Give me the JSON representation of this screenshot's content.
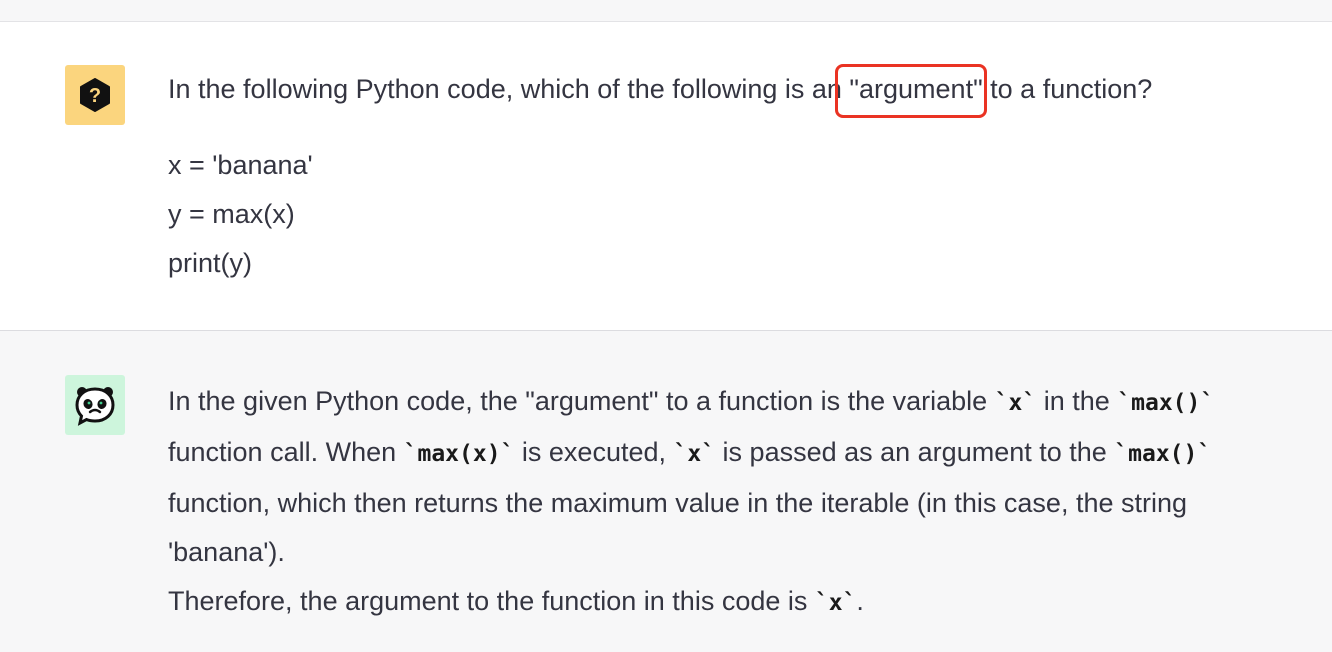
{
  "question": {
    "text_before": "In the following Python code, which of the following is an ",
    "highlight": "\"argument\"",
    "text_after": " to a function?",
    "code_lines": [
      "x = 'banana'",
      "y = max(x)",
      "print(y)"
    ]
  },
  "answer": {
    "p1_a": "In the given Python code, the \"argument\" to a function is the variable ",
    "p1_code1": "`x`",
    "p1_b": " in the ",
    "p1_code2": "`max()`",
    "p1_c": " function call. When ",
    "p1_code3": "`max(x)`",
    "p1_d": " is executed, ",
    "p1_code4": "`x`",
    "p1_e": " is passed as an argument to the ",
    "p1_code5": "`max()`",
    "p1_f": " function, which then returns the maximum value in the iterable (in this case, the string 'banana').",
    "p2_a": "Therefore, the argument to the function in this code is ",
    "p2_code": "`x`",
    "p2_b": "."
  },
  "colors": {
    "highlight_border": "#ea3323",
    "user_avatar_bg": "#fbd57e",
    "bot_avatar_bg": "#cdf5dc"
  },
  "icons": {
    "user_avatar": "question-hexagon-icon",
    "bot_avatar": "panda-chat-icon"
  }
}
